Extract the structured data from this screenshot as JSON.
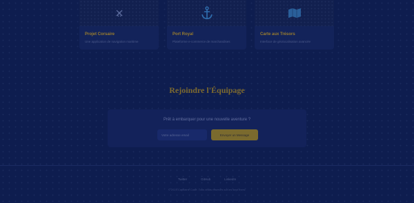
{
  "cards": [
    {
      "title": "Projet Corsaire",
      "desc": "Une application de navigation maritime",
      "icon": "crossed-swords-icon"
    },
    {
      "title": "Port Royal",
      "desc": "Plateforme e-commerce de marchandises",
      "icon": "anchor-icon"
    },
    {
      "title": "Carte aux Trésors",
      "desc": "Interface de géolocalisation avancée",
      "icon": "map-icon"
    }
  ],
  "join": {
    "title": "Rejoindre l'Équipage",
    "subtitle": "Prêt à embarquer pour une nouvelle aventure ?",
    "email_placeholder": "Votre adresse email",
    "button_label": "Envoyer un Message"
  },
  "footer": {
    "links": [
      "Twitter",
      "GitHub",
      "LinkedIn"
    ],
    "copyright": "© 2024 Capitaine Code. Tous droits réservés sur les sept mers."
  },
  "colors": {
    "background": "#0e1d4f",
    "accent_gold": "#7a6a2e",
    "card_bg": "#13235a"
  }
}
